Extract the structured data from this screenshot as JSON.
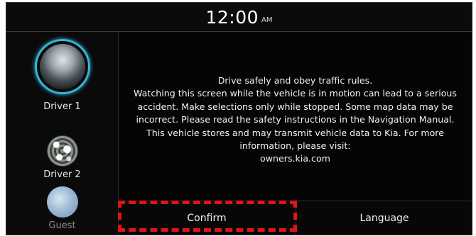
{
  "status_bar": {
    "time": "12:00",
    "ampm": "AM"
  },
  "profiles": [
    {
      "name": "Driver 1"
    },
    {
      "name": "Driver 2"
    },
    {
      "name": "Guest"
    }
  ],
  "message": {
    "lines": [
      "Drive safely and obey traffic rules.",
      "Watching this screen while the vehicle is in motion can lead to a serious",
      "accident. Make selections only while stopped. Some map data may be",
      "incorrect. Please read the safety instructions in the Navigation Manual.",
      "This vehicle stores and may transmit vehicle data to Kia. For more",
      "information, please visit:",
      "owners.kia.com"
    ]
  },
  "buttons": {
    "confirm": "Confirm",
    "language": "Language"
  },
  "colors": {
    "highlight": "#e01515",
    "active_ring": "#35b6d9"
  }
}
